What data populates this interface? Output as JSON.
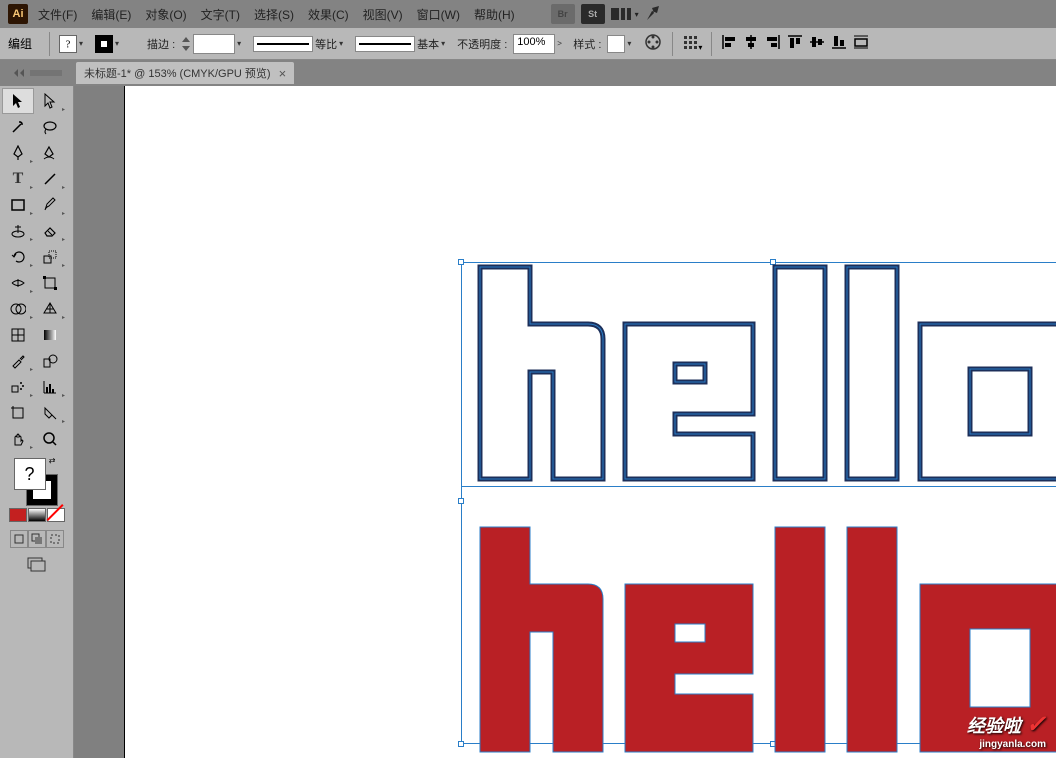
{
  "app": {
    "logo": "Ai"
  },
  "menu": {
    "file": "文件(F)",
    "edit": "编辑(E)",
    "object": "对象(O)",
    "type": "文字(T)",
    "select": "选择(S)",
    "effect": "效果(C)",
    "view": "视图(V)",
    "window": "窗口(W)",
    "help": "帮助(H)"
  },
  "options": {
    "group_label": "编组",
    "stroke_label": "描边 :",
    "stroke_weight": "",
    "profile_label": "等比",
    "brush_label": "基本",
    "opacity_label": "不透明度 :",
    "opacity_value": "100%",
    "style_label": "样式 :"
  },
  "tab": {
    "title": "未标题-1* @ 153% (CMYK/GPU 预览)",
    "close": "×"
  },
  "canvas": {
    "text_outline": "hello",
    "text_fill": "hello",
    "outline_color": "#1c2f5a",
    "fill_color": "#b92025",
    "selection_color": "#2a7ec8"
  },
  "watermark": {
    "main": "经验啦",
    "sub": "jingyanla.com",
    "check": "✓"
  },
  "icons": {
    "br": "Br",
    "st": "St"
  }
}
